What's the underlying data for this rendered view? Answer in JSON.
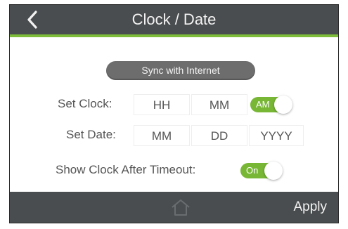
{
  "header": {
    "title": "Clock / Date",
    "back_icon": "chevron-left-icon"
  },
  "sync_button": {
    "label": "Sync with Internet"
  },
  "set_clock": {
    "label": "Set Clock:",
    "hour_placeholder": "HH",
    "minute_placeholder": "MM",
    "ampm_toggle": {
      "value": "AM",
      "on": true
    }
  },
  "set_date": {
    "label": "Set Date:",
    "month_placeholder": "MM",
    "day_placeholder": "DD",
    "year_placeholder": "YYYY"
  },
  "show_clock": {
    "label": "Show Clock After Timeout:",
    "toggle": {
      "value": "On",
      "on": true
    }
  },
  "footer": {
    "home_icon": "home-icon",
    "apply_label": "Apply"
  },
  "colors": {
    "header_bg": "#4a4d4f",
    "accent": "#7dbd3a",
    "toggle_on": "#78b735",
    "button_bg": "#6d6d6d"
  }
}
